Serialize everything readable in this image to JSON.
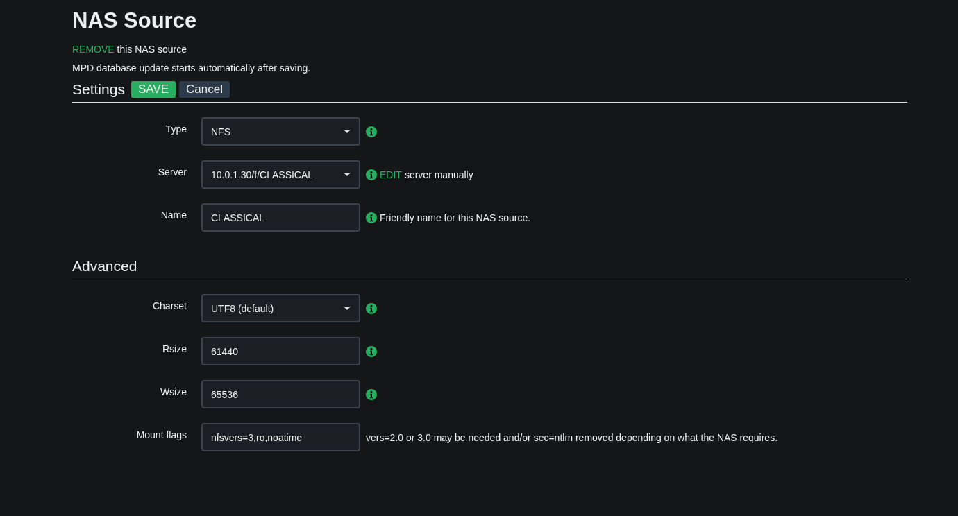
{
  "page": {
    "title": "NAS Source",
    "remove_link": "REMOVE",
    "remove_text": "this NAS source",
    "note": "MPD database update starts automatically after saving."
  },
  "sections": [
    {
      "title": "Settings",
      "buttons": [
        {
          "label": "SAVE",
          "kind": "primary"
        },
        {
          "label": "Cancel",
          "kind": "secondary"
        }
      ],
      "rows": [
        {
          "label": "Type",
          "kind": "select",
          "value": "NFS",
          "info": true
        },
        {
          "label": "Server",
          "kind": "select",
          "value": "10.0.1.30/f/CLASSICAL",
          "info": true,
          "help_link": "EDIT",
          "help": "server manually"
        },
        {
          "label": "Name",
          "kind": "text",
          "value": "CLASSICAL",
          "info": true,
          "help": "Friendly name for this NAS source."
        }
      ]
    },
    {
      "title": "Advanced",
      "rows": [
        {
          "label": "Charset",
          "kind": "select",
          "value": "UTF8 (default)",
          "info": true
        },
        {
          "label": "Rsize",
          "kind": "text",
          "value": "61440",
          "info": true
        },
        {
          "label": "Wsize",
          "kind": "text",
          "value": "65536",
          "info": true
        },
        {
          "label": "Mount flags",
          "kind": "text",
          "value": "nfsvers=3,ro,noatime",
          "info": false,
          "help": "vers=2.0 or 3.0 may be needed and/or sec=ntlm removed depending on what the NAS requires."
        }
      ]
    }
  ]
}
